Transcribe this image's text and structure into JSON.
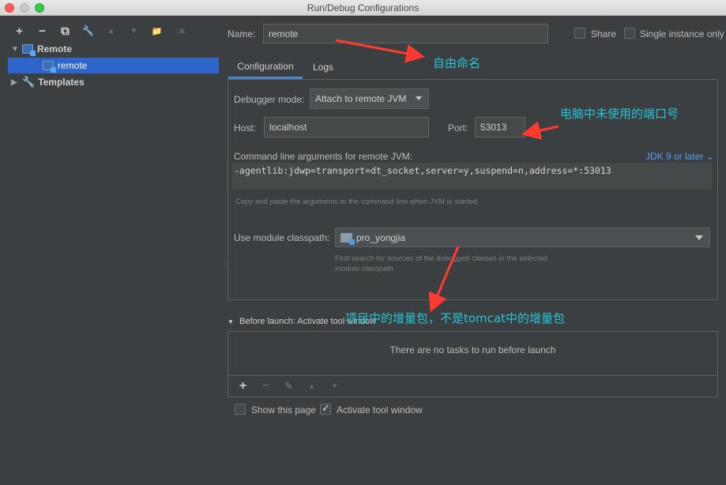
{
  "window": {
    "title": "Run/Debug Configurations"
  },
  "toolbar": {
    "add": "+",
    "remove": "−",
    "copy": "⧉",
    "edit": "🔧",
    "up": "▲",
    "down": "▼",
    "folder": "📁",
    "sort": "↓a"
  },
  "tree": {
    "root_label": "Remote",
    "child_label": "remote",
    "templates_label": "Templates"
  },
  "name_row": {
    "label": "Name:",
    "value": "remote",
    "share_label": "Share",
    "single_label": "Single instance only"
  },
  "tabs": [
    {
      "label": "Configuration",
      "active": true
    },
    {
      "label": "Logs",
      "active": false
    }
  ],
  "config": {
    "debugger_mode_label": "Debugger mode:",
    "debugger_mode_value": "Attach to remote JVM",
    "host_label": "Host:",
    "host_value": "localhost",
    "port_label": "Port:",
    "port_value": "53013",
    "cmd_label": "Command line arguments for remote JVM:",
    "jdk_link": "JDK 9 or later ⌄",
    "cmd_value": "-agentlib:jdwp=transport=dt_socket,server=y,suspend=n,address=*:53013",
    "cmd_hint": "Copy and paste the arguments to the command line when JVM is started",
    "classpath_label": "Use module classpath:",
    "classpath_value": "pro_yongjia",
    "classpath_hint_1": "First search for sources of the debugged classes in the selected",
    "classpath_hint_2": "module classpath"
  },
  "before_launch": {
    "title": "Before launch: Activate tool window",
    "empty_text": "There are no tasks to run before launch",
    "add": "+",
    "remove": "−",
    "edit": "✎",
    "up": "▲",
    "down": "▼"
  },
  "bottom": {
    "show_page_label": "Show this page",
    "activate_label": "Activate tool window"
  },
  "annotations": {
    "name_note": "自由命名",
    "port_note": "电脑中未使用的端口号",
    "classpath_note": "项目中的增量包，不是tomcat中的增量包"
  },
  "colors": {
    "background": "#3c3f41",
    "selection": "#2f65ca",
    "annotation_text": "#25c4d6",
    "annotation_arrow": "#ff3b30",
    "link": "#589df6"
  }
}
